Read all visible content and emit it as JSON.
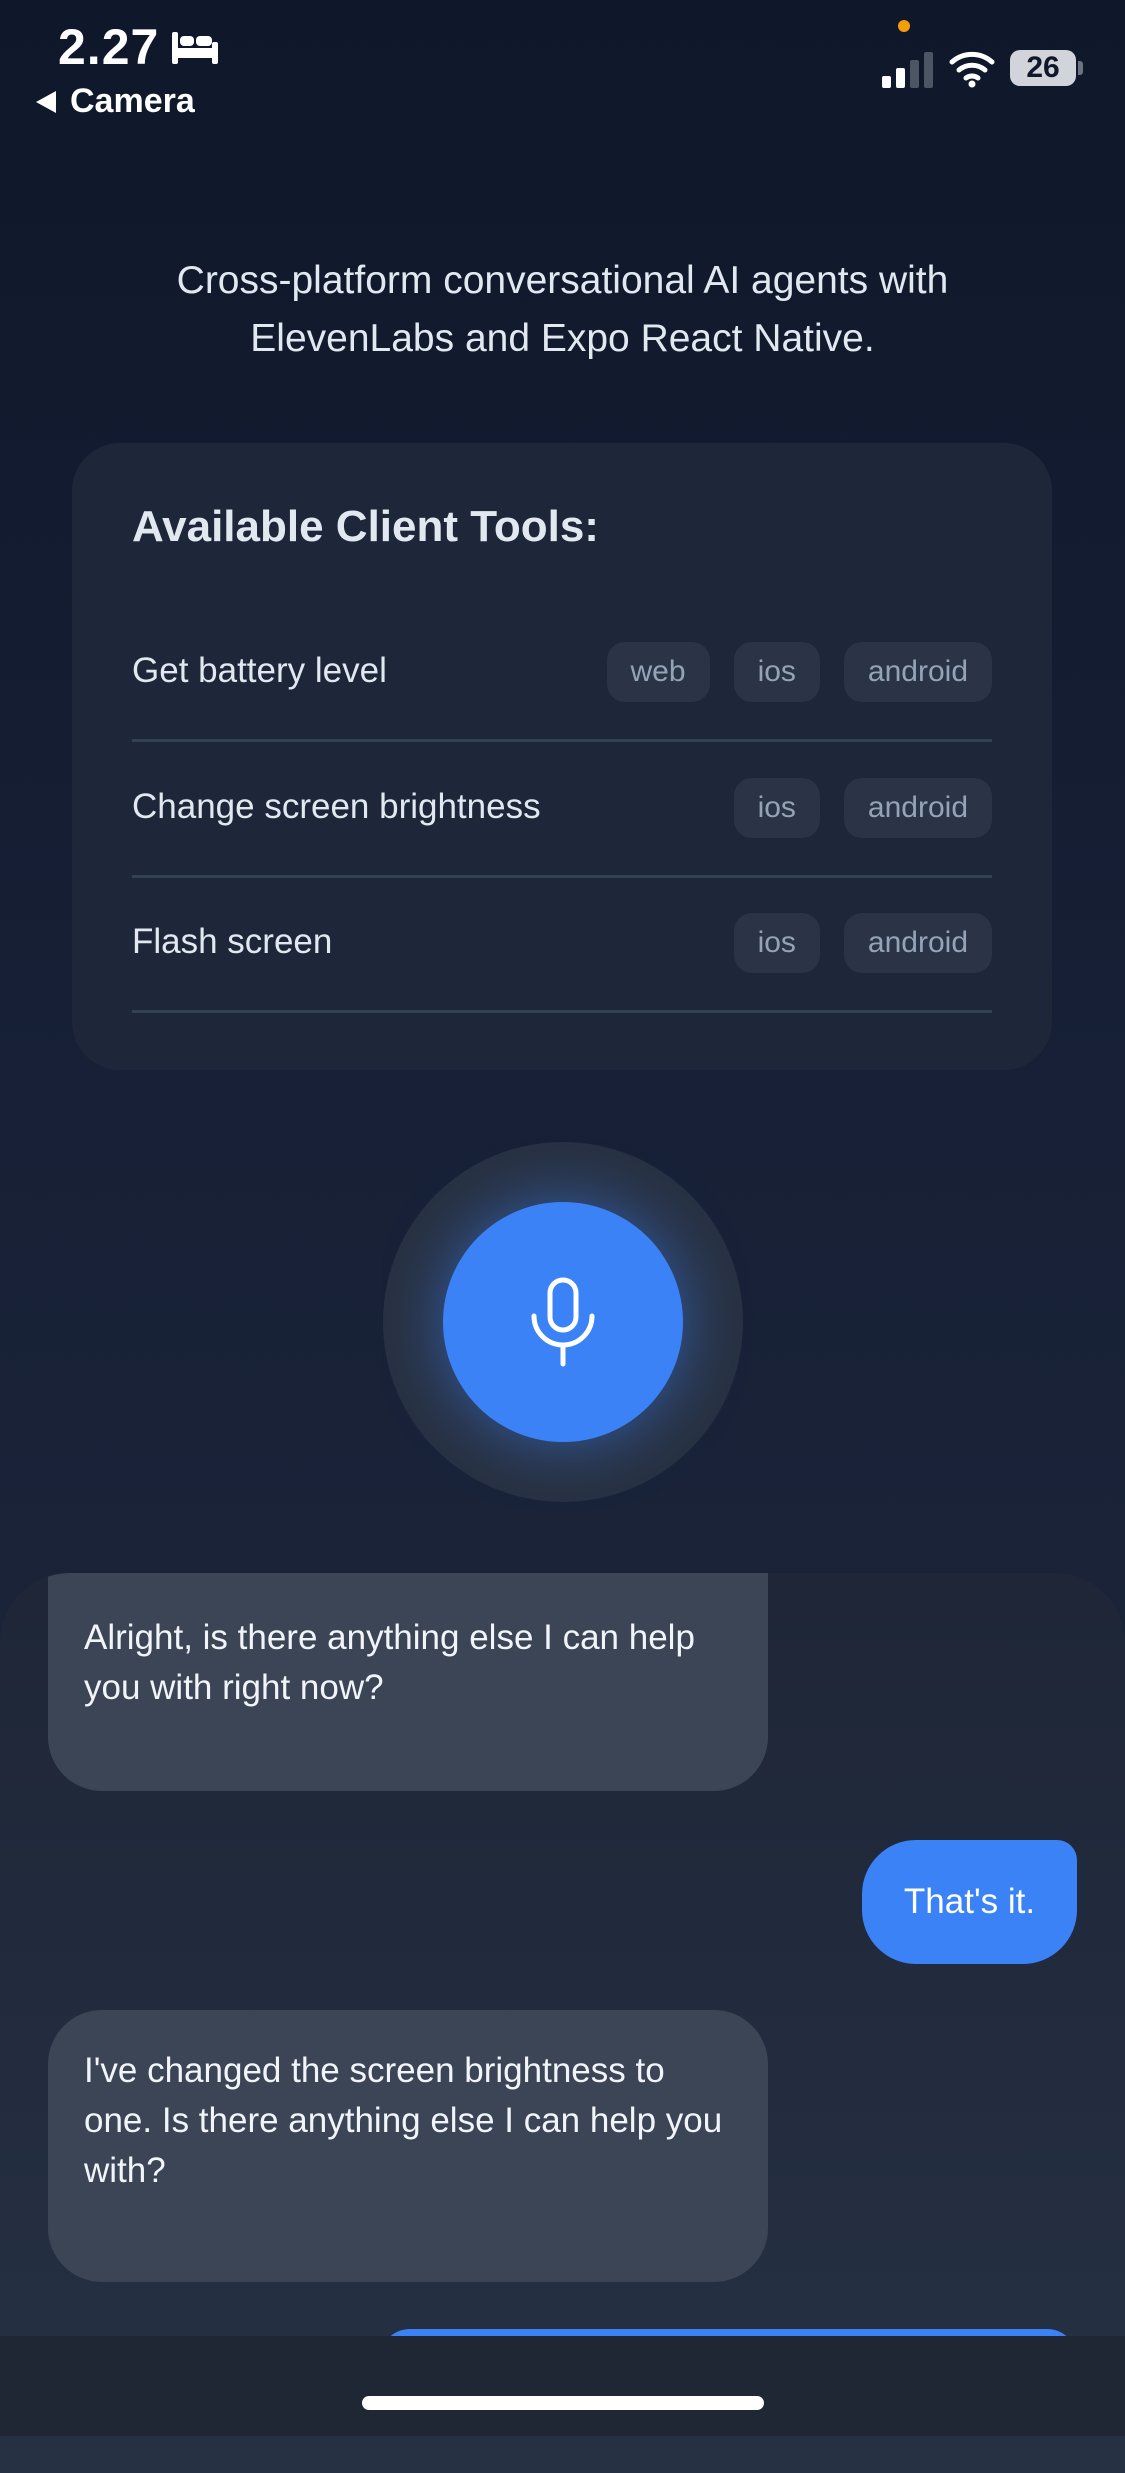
{
  "status_bar": {
    "time": "2.27",
    "back_label": "Camera",
    "battery": "26",
    "icons": [
      "bed-icon",
      "signal-icon",
      "wifi-icon",
      "battery-icon"
    ]
  },
  "intro": {
    "text": "Cross-platform conversational AI agents with ElevenLabs and Expo React Native."
  },
  "tools": {
    "title": "Available Client Tools:",
    "items": [
      {
        "name": "Get battery level",
        "platforms": [
          "web",
          "ios",
          "android"
        ]
      },
      {
        "name": "Change screen brightness",
        "platforms": [
          "ios",
          "android"
        ]
      },
      {
        "name": "Flash screen",
        "platforms": [
          "ios",
          "android"
        ]
      }
    ]
  },
  "mic": {
    "icon": "microphone-icon",
    "accent": "#3b82f6"
  },
  "chat": {
    "messages": [
      {
        "role": "agent",
        "text": "Alright, is there anything else I can help you with right now?"
      },
      {
        "role": "user",
        "text": "That's it."
      },
      {
        "role": "agent",
        "text": "I've changed the screen brightness to one. Is there anything else I can help you with?"
      },
      {
        "role": "user",
        "text": ""
      }
    ]
  },
  "colors": {
    "background": "#0f172a",
    "card": "#1e2639",
    "badge": "#2b3446",
    "agent_bubble": "#3c4556",
    "user_bubble": "#3b82f6"
  }
}
